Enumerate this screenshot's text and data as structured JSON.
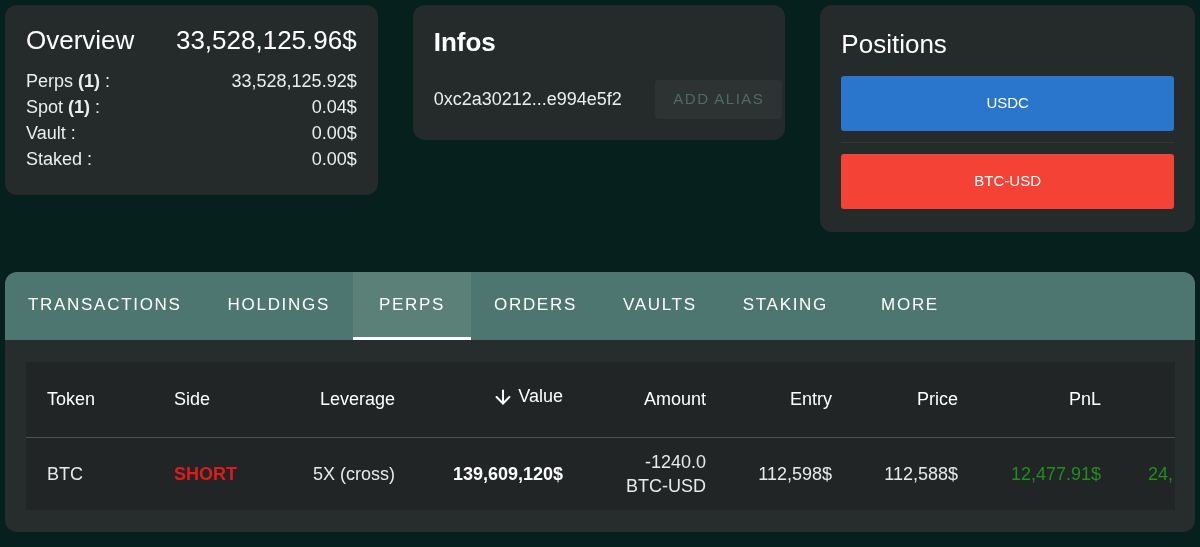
{
  "overview": {
    "title": "Overview",
    "total": "33,528,125.96$",
    "lines": [
      {
        "label": "Perps **(1)** :",
        "value": "33,528,125.92$"
      },
      {
        "label": "Spot **(1)** :",
        "value": "0.04$"
      },
      {
        "label": "Vault :",
        "value": "0.00$"
      },
      {
        "label": "Staked :",
        "value": "0.00$"
      }
    ]
  },
  "infos": {
    "title": "Infos",
    "address": "0xc2a30212...e994e5f2",
    "button": "ADD ALIAS"
  },
  "positions": {
    "title": "Positions",
    "items": [
      {
        "label": "USDC",
        "color": "#2a76cc"
      },
      {
        "label": "BTC-USD",
        "color": "#f44336"
      }
    ]
  },
  "tabs": [
    {
      "label": "TRANSACTIONS",
      "selected": false
    },
    {
      "label": "HOLDINGS",
      "selected": false
    },
    {
      "label": "PERPS",
      "selected": true
    },
    {
      "label": "ORDERS",
      "selected": false
    },
    {
      "label": "VAULTS",
      "selected": false
    },
    {
      "label": "STAKING",
      "selected": false
    },
    {
      "label": "MORE",
      "selected": false
    }
  ],
  "table": {
    "columns": [
      {
        "label": "Token",
        "sorted": false
      },
      {
        "label": "Side",
        "sorted": false
      },
      {
        "label": "Leverage",
        "sorted": false
      },
      {
        "label": "Value",
        "sorted": true
      },
      {
        "label": "Amount",
        "sorted": false
      },
      {
        "label": "Entry",
        "sorted": false
      },
      {
        "label": "Price",
        "sorted": false
      },
      {
        "label": "PnL",
        "sorted": false
      }
    ],
    "rows": [
      {
        "cells": [
          {
            "kind": "plain",
            "lines": [
              "BTC"
            ]
          },
          {
            "kind": "short",
            "lines": [
              "SHORT"
            ]
          },
          {
            "kind": "plain",
            "lines": [
              "5X (cross)"
            ]
          },
          {
            "kind": "bold",
            "lines": [
              "139,609,120$"
            ]
          },
          {
            "kind": "plain",
            "lines": [
              "-1240.0",
              "BTC-USD"
            ]
          },
          {
            "kind": "plain",
            "lines": [
              "112,598$"
            ]
          },
          {
            "kind": "plain",
            "lines": [
              "112,588$"
            ]
          },
          {
            "kind": "profit",
            "lines": [
              "12,477.91$"
            ]
          },
          {
            "kind": "profit",
            "lines": [
              "24,"
            ]
          }
        ]
      }
    ]
  }
}
